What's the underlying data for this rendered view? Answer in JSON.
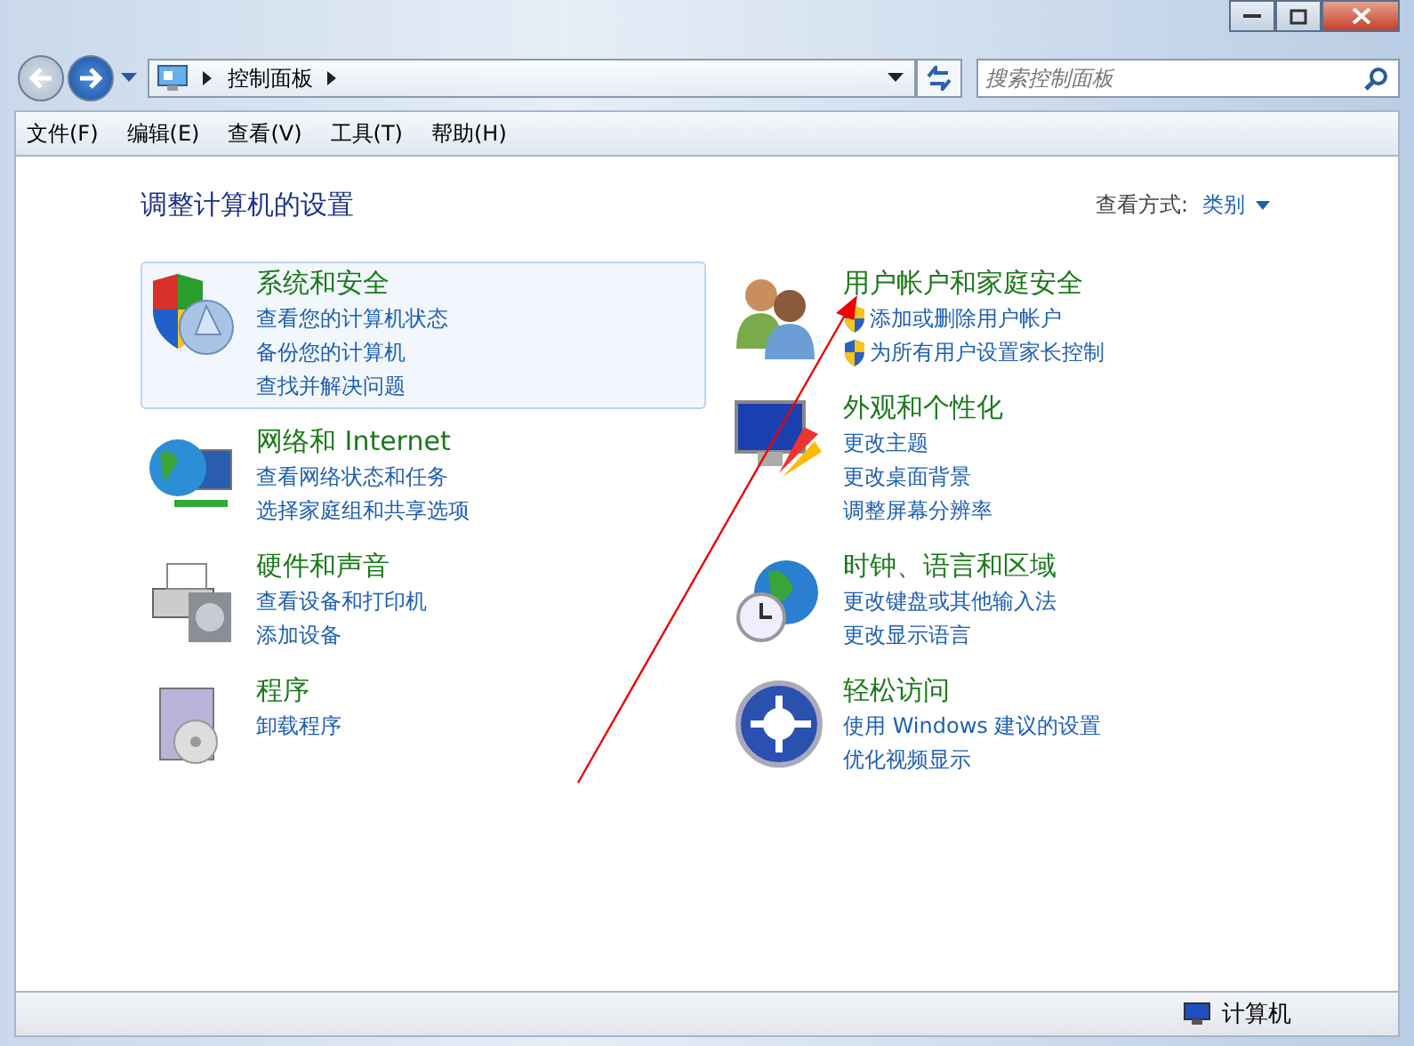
{
  "address_bar": {
    "path": "控制面板",
    "search": {
      "placeholder": "搜索控制面板"
    }
  },
  "menu_bar": [
    "文件(F)",
    "编辑(E)",
    "查看(V)",
    "工具(T)",
    "帮助(H)"
  ],
  "content": {
    "heading": "调整计算机的设置",
    "view_by": {
      "label": "查看方式:",
      "value": "类别"
    },
    "columns": [
      [
        {
          "title": "系统和安全",
          "selected": true,
          "links": [
            {
              "text": "查看您的计算机状态",
              "shield": false
            },
            {
              "text": "备份您的计算机",
              "shield": false
            },
            {
              "text": "查找并解决问题",
              "shield": false
            }
          ]
        },
        {
          "title": "网络和 Internet",
          "selected": false,
          "links": [
            {
              "text": "查看网络状态和任务",
              "shield": false
            },
            {
              "text": "选择家庭组和共享选项",
              "shield": false
            }
          ]
        },
        {
          "title": "硬件和声音",
          "selected": false,
          "links": [
            {
              "text": "查看设备和打印机",
              "shield": false
            },
            {
              "text": "添加设备",
              "shield": false
            }
          ]
        },
        {
          "title": "程序",
          "selected": false,
          "links": [
            {
              "text": "卸载程序",
              "shield": false
            }
          ]
        }
      ],
      [
        {
          "title": "用户帐户和家庭安全",
          "selected": false,
          "links": [
            {
              "text": "添加或删除用户帐户",
              "shield": true
            },
            {
              "text": "为所有用户设置家长控制",
              "shield": true
            }
          ]
        },
        {
          "title": "外观和个性化",
          "selected": false,
          "links": [
            {
              "text": "更改主题",
              "shield": false
            },
            {
              "text": "更改桌面背景",
              "shield": false
            },
            {
              "text": "调整屏幕分辨率",
              "shield": false
            }
          ]
        },
        {
          "title": "时钟、语言和区域",
          "selected": false,
          "links": [
            {
              "text": "更改键盘或其他输入法",
              "shield": false
            },
            {
              "text": "更改显示语言",
              "shield": false
            }
          ]
        },
        {
          "title": "轻松访问",
          "selected": false,
          "links": [
            {
              "text": "使用 Windows 建议的设置",
              "shield": false
            },
            {
              "text": "优化视频显示",
              "shield": false
            }
          ]
        }
      ]
    ]
  },
  "status_bar": {
    "location": "计算机"
  }
}
